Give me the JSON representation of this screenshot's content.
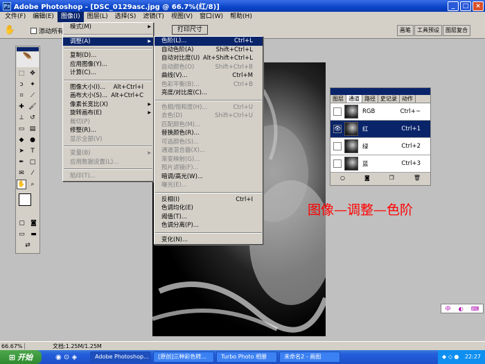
{
  "window": {
    "title": "Adobe Photoshop - [DSC_0129asc.jpg @ 66.7%(红/8)]",
    "btn_min": "_",
    "btn_max": "□",
    "btn_close": "×"
  },
  "menubar": [
    "文件(F)",
    "编辑(E)",
    "图像(I)",
    "图层(L)",
    "选择(S)",
    "滤镜(T)",
    "视图(V)",
    "窗口(W)",
    "帮助(H)"
  ],
  "options": {
    "checkbox_label": "添动所有",
    "print_size": "打印尺寸"
  },
  "palette_tabs": [
    "画笔",
    "工具预设",
    "图层复合"
  ],
  "image_menu": [
    {
      "label": "模式(M)",
      "sub": true
    },
    {
      "sep": true
    },
    {
      "label": "调整(A)",
      "sub": true,
      "hl": true
    },
    {
      "sep": true
    },
    {
      "label": "复制(D)..."
    },
    {
      "label": "应用图像(Y)..."
    },
    {
      "label": "计算(C)..."
    },
    {
      "sep": true
    },
    {
      "label": "图像大小(I)...",
      "sc": "Alt+Ctrl+I"
    },
    {
      "label": "画布大小(S)...",
      "sc": "Alt+Ctrl+C"
    },
    {
      "label": "像素长宽比(X)",
      "sub": true
    },
    {
      "label": "旋转画布(E)",
      "sub": true
    },
    {
      "label": "裁切(P)",
      "dis": true
    },
    {
      "label": "修整(R)..."
    },
    {
      "label": "显示全部(V)",
      "dis": true
    },
    {
      "sep": true
    },
    {
      "label": "变量(B)",
      "sub": true,
      "dis": true
    },
    {
      "label": "应用数据设置(L)...",
      "dis": true
    },
    {
      "sep": true
    },
    {
      "label": "陷印(T)...",
      "dis": true
    }
  ],
  "adjust_menu": [
    {
      "label": "色阶(L)...",
      "sc": "Ctrl+L",
      "hl": true
    },
    {
      "label": "自动色阶(A)",
      "sc": "Shift+Ctrl+L"
    },
    {
      "label": "自动对比度(U)",
      "sc": "Alt+Shift+Ctrl+L"
    },
    {
      "label": "自动颜色(O)",
      "sc": "Shift+Ctrl+B",
      "dis": true
    },
    {
      "label": "曲线(V)...",
      "sc": "Ctrl+M"
    },
    {
      "label": "色彩平衡(B)...",
      "sc": "Ctrl+B",
      "dis": true
    },
    {
      "label": "亮度/对比度(C)..."
    },
    {
      "sep": true
    },
    {
      "label": "色相/饱和度(H)...",
      "sc": "Ctrl+U",
      "dis": true
    },
    {
      "label": "去色(D)",
      "sc": "Shift+Ctrl+U",
      "dis": true
    },
    {
      "label": "匹配颜色(M)...",
      "dis": true
    },
    {
      "label": "替换颜色(R)..."
    },
    {
      "label": "可选颜色(S)...",
      "dis": true
    },
    {
      "label": "通道混合器(X)...",
      "dis": true
    },
    {
      "label": "渐变映射(G)...",
      "dis": true
    },
    {
      "label": "照片滤镜(F)...",
      "dis": true
    },
    {
      "label": "暗调/高光(W)..."
    },
    {
      "label": "曝光(E)...",
      "dis": true
    },
    {
      "sep": true
    },
    {
      "label": "反相(I)",
      "sc": "Ctrl+I"
    },
    {
      "label": "色调均化(E)"
    },
    {
      "label": "阈值(T)..."
    },
    {
      "label": "色调分离(P)..."
    },
    {
      "sep": true
    },
    {
      "label": "变化(N)..."
    }
  ],
  "channels": {
    "tabs": [
      "图层",
      "通道",
      "路径",
      "史记录",
      "动作"
    ],
    "rows": [
      {
        "name": "RGB",
        "sc": "Ctrl+~"
      },
      {
        "name": "红",
        "sc": "Ctrl+1",
        "on": true
      },
      {
        "name": "绿",
        "sc": "Ctrl+2"
      },
      {
        "name": "蓝",
        "sc": "Ctrl+3"
      }
    ]
  },
  "caption": "图像—调整—色阶",
  "status": {
    "zoom": "66.67%",
    "doc": "文档:1.25M/1.25M"
  },
  "taskbar": {
    "start": "开始",
    "tasks": [
      "Adobe Photoshop...",
      "[原创]三种彩色转...",
      "Turbo Photo 相册",
      "未命名2 - 画图"
    ],
    "clock": "22:27"
  },
  "colors": {
    "menu_highlight": "#0a246a",
    "caption": "#ff0000"
  }
}
